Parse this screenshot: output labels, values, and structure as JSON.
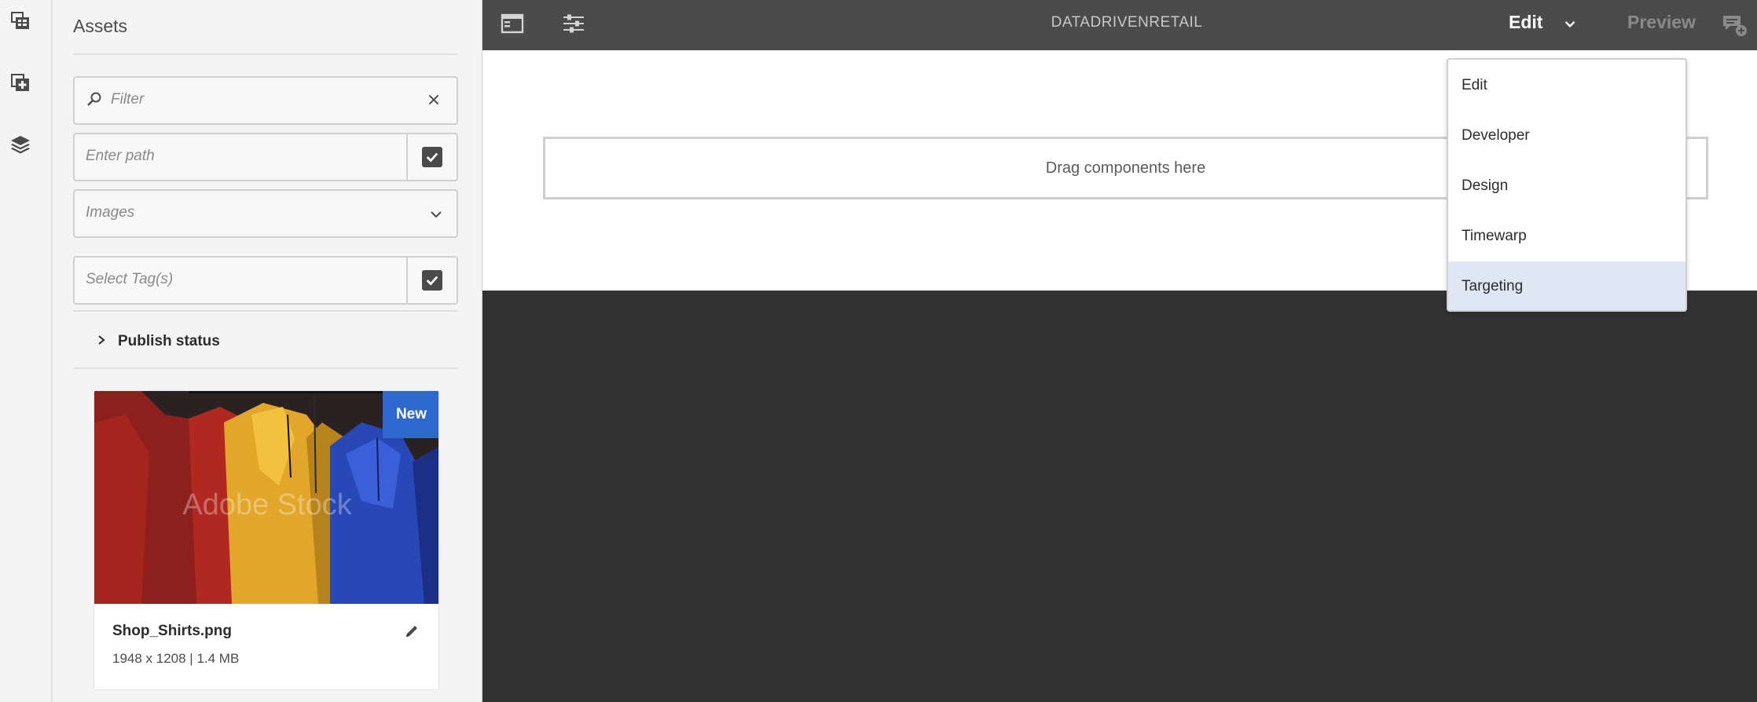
{
  "rail": {
    "items": [
      {
        "icon": "asset-finder-icon"
      },
      {
        "icon": "components-icon"
      },
      {
        "icon": "layers-icon"
      }
    ]
  },
  "assets_panel": {
    "title": "Assets",
    "filter": {
      "placeholder": "Filter",
      "icon": "search-icon",
      "clear_icon": "close-icon"
    },
    "path": {
      "placeholder": "Enter path",
      "check_icon": "checkmark-icon"
    },
    "type_select": {
      "value": "Images",
      "icon": "chevron-down-icon"
    },
    "tags": {
      "placeholder": "Select Tag(s)",
      "check_icon": "checkmark-icon"
    },
    "publish_status": {
      "label": "Publish status",
      "icon": "chevron-right-icon"
    },
    "card": {
      "badge": "New",
      "name": "Shop_Shirts.png",
      "meta": "1948 x 1208 | 1.4 MB",
      "edit_icon": "pencil-icon",
      "watermark": "Adobe Stock"
    }
  },
  "topbar": {
    "title": "DATADRIVENRETAIL",
    "left_icons": [
      "toggle-side-panel-icon",
      "page-properties-icon"
    ],
    "mode_label": "Edit",
    "mode_icon": "chevron-down-icon",
    "preview_label": "Preview",
    "right_icon": "annotations-icon"
  },
  "canvas": {
    "dropzone_text": "Drag components here"
  },
  "mode_menu": {
    "items": [
      {
        "label": "Edit"
      },
      {
        "label": "Developer"
      },
      {
        "label": "Design"
      },
      {
        "label": "Timewarp"
      },
      {
        "label": "Targeting",
        "selected": true
      }
    ]
  },
  "colors": {
    "dark_bg": "#323232",
    "topbar": "#4b4b4b",
    "panel_bg": "#f4f4f4",
    "badge": "#2d68d0",
    "selected_item": "#dfe6f4"
  }
}
